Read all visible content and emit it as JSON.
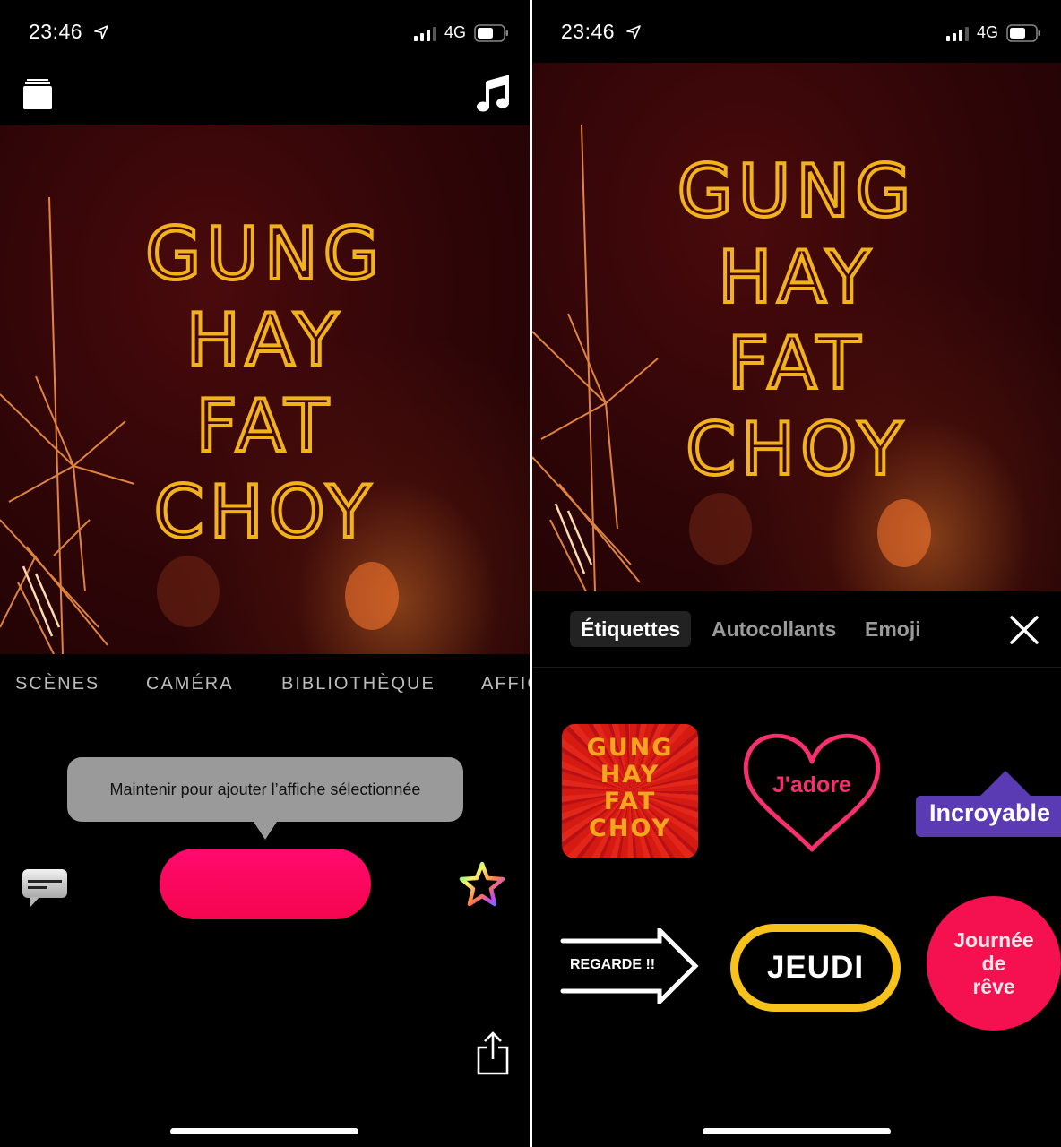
{
  "status_bar": {
    "time": "23:46",
    "network": "4G",
    "icons": [
      "location-arrow-icon",
      "signal-icon",
      "battery-icon"
    ]
  },
  "left_screen": {
    "top_bar": {
      "library_icon": "projects-stack-icon",
      "music_icon": "music-note-icon"
    },
    "poster": {
      "lines": [
        "GUNG",
        "HAY",
        "FAT",
        "CHOY"
      ],
      "text_color": "#f2b21c"
    },
    "mode_tabs": [
      "SCÈNES",
      "CAMÉRA",
      "BIBLIOTHÈQUE",
      "AFFICHES"
    ],
    "mode_tabs_visible_text": [
      "SCÈNES",
      "CAMÉRA",
      "BIBLIOTHÈQUE",
      "AFFIC"
    ],
    "tooltip": "Maintenir pour ajouter l’affiche sélectionnée",
    "record_button": {
      "label": "",
      "color": "#ff0a6e"
    },
    "caption_icon": "live-titles-icon",
    "effects_icon": "effects-star-icon",
    "share_icon": "share-icon"
  },
  "right_screen": {
    "poster": {
      "lines": [
        "GUNG",
        "HAY",
        "FAT",
        "CHOY"
      ]
    },
    "tabs": [
      {
        "label": "Étiquettes",
        "active": true
      },
      {
        "label": "Autocollants",
        "active": false
      },
      {
        "label": "Emoji",
        "active": false
      }
    ],
    "close_icon": "close-icon",
    "stickers": {
      "poster": {
        "lines": [
          "GUNG",
          "HAY",
          "FAT",
          "CHOY"
        ],
        "bg": "#d51a12",
        "fg": "#f6a51e"
      },
      "heart": {
        "label": "J'adore",
        "color": "#f5306d"
      },
      "incroyable": {
        "label": "Incroyable",
        "bg": "#5b3bb3"
      },
      "arrow": {
        "label": "REGARDE !!"
      },
      "jeudi": {
        "label": "JEUDI",
        "border": "#f7c21c"
      },
      "journee": {
        "lines": [
          "Journée",
          "de",
          "rêve"
        ],
        "bg": "#f5104f"
      }
    }
  }
}
